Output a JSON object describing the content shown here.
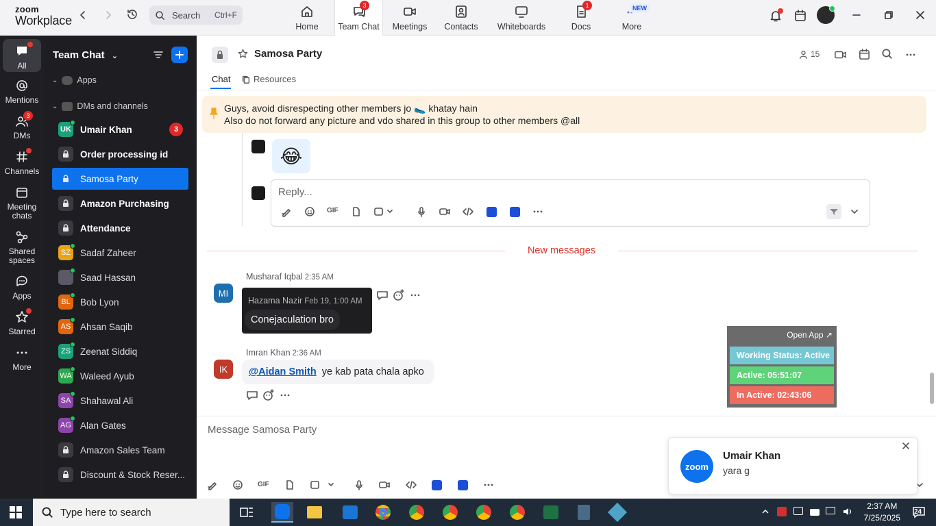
{
  "app": {
    "brand_line1": "zoom",
    "brand_line2": "Workplace"
  },
  "search": {
    "placeholder": "Search",
    "shortcut": "Ctrl+F"
  },
  "tabs": [
    {
      "label": "Home",
      "icon": "home-icon"
    },
    {
      "label": "Team Chat",
      "icon": "chat-icon",
      "badge": "3",
      "active": true
    },
    {
      "label": "Meetings",
      "icon": "video-icon"
    },
    {
      "label": "Contacts",
      "icon": "contacts-icon"
    },
    {
      "label": "Whiteboards",
      "icon": "whiteboard-icon"
    },
    {
      "label": "Docs",
      "icon": "docs-icon",
      "badge": "1"
    },
    {
      "label": "More",
      "icon": "more-icon",
      "tag": "NEW"
    }
  ],
  "rail": [
    {
      "label": "All",
      "icon": "chat-bubble-icon"
    },
    {
      "label": "Mentions",
      "icon": "at-icon"
    },
    {
      "label": "DMs",
      "icon": "people-icon",
      "badge": "3"
    },
    {
      "label": "Channels",
      "icon": "hash-icon"
    },
    {
      "label": "Meeting chats",
      "icon": "calendar-icon"
    },
    {
      "label": "Shared spaces",
      "icon": "share-icon"
    },
    {
      "label": "Apps",
      "icon": "apps-icon"
    },
    {
      "label": "Starred",
      "icon": "star-icon"
    },
    {
      "label": "More",
      "icon": "more-icon"
    }
  ],
  "sidebar": {
    "title": "Team Chat",
    "apps_label": "Apps",
    "dms_label": "DMs and channels",
    "items": [
      {
        "name": "Umair Khan",
        "type": "dm",
        "initials": "UK",
        "color": "#1aa17a",
        "bold": true,
        "badge": "3"
      },
      {
        "name": "Order processing id",
        "type": "channel",
        "bold": true
      },
      {
        "name": "Samosa Party",
        "type": "channel",
        "selected": true
      },
      {
        "name": "Amazon Purchasing",
        "type": "channel",
        "bold": true
      },
      {
        "name": "Attendance",
        "type": "channel",
        "bold": true
      },
      {
        "name": "Sadaf Zaheer",
        "type": "dm",
        "initials": "SZ",
        "color": "#e8a317"
      },
      {
        "name": "Saad Hassan",
        "type": "dm",
        "initials": "",
        "color": "#5a5a66"
      },
      {
        "name": "Bob Lyon",
        "type": "dm",
        "initials": "BL",
        "color": "#e06610"
      },
      {
        "name": "Ahsan Saqib",
        "type": "dm",
        "initials": "AS",
        "color": "#e06610"
      },
      {
        "name": "Zeenat Siddiq",
        "type": "dm",
        "initials": "ZS",
        "color": "#1aa17a"
      },
      {
        "name": "Waleed Ayub",
        "type": "dm",
        "initials": "WA",
        "color": "#2ea84f"
      },
      {
        "name": "Shahawal Ali",
        "type": "dm",
        "initials": "SA",
        "color": "#8e44ad"
      },
      {
        "name": "Alan Gates",
        "type": "dm",
        "initials": "AG",
        "color": "#8e44ad"
      },
      {
        "name": "Amazon Sales Team",
        "type": "channel"
      },
      {
        "name": "Discount & Stock Reser...",
        "type": "channel"
      }
    ]
  },
  "channel": {
    "title": "Samosa Party",
    "members": "15",
    "tab_chat": "Chat",
    "tab_resources": "Resources",
    "pinned_line1": "Guys, avoid disrespecting other members jo 🥿 khatay hain",
    "pinned_line2": "Also do not forward any picture and vdo shared in this group to other members @all",
    "reply_placeholder": "Reply...",
    "new_messages": "New messages",
    "message_placeholder": "Message Samosa Party"
  },
  "messages": [
    {
      "initials": "MI",
      "color": "#1f6fae",
      "author": "Musharaf Iqbal",
      "time": "2:35 AM",
      "quote_author": "Hazama Nazir",
      "quote_time": "Feb 19, 1:00 AM",
      "quote_text": "Conejaculation bro"
    },
    {
      "initials": "IK",
      "color": "#c0392b",
      "author": "Imran Khan",
      "time": "2:36 AM",
      "mention": "@Aidan Smith",
      "text": "ye kab pata chala apko"
    }
  ],
  "widget": {
    "open_app": "Open App ↗",
    "working_status": "Working Status: Active",
    "active": "Active: 05:51:07",
    "inactive": "In Active: 02:43:06",
    "colors": {
      "status": "#76c7d4",
      "active": "#5fd37a",
      "inactive": "#ee6b60"
    }
  },
  "toast": {
    "logo": "zoom",
    "name": "Umair Khan",
    "text": "yara g"
  },
  "taskbar": {
    "search_placeholder": "Type here to search",
    "time": "2:37 AM",
    "date": "7/25/2025",
    "notifications": "24"
  }
}
